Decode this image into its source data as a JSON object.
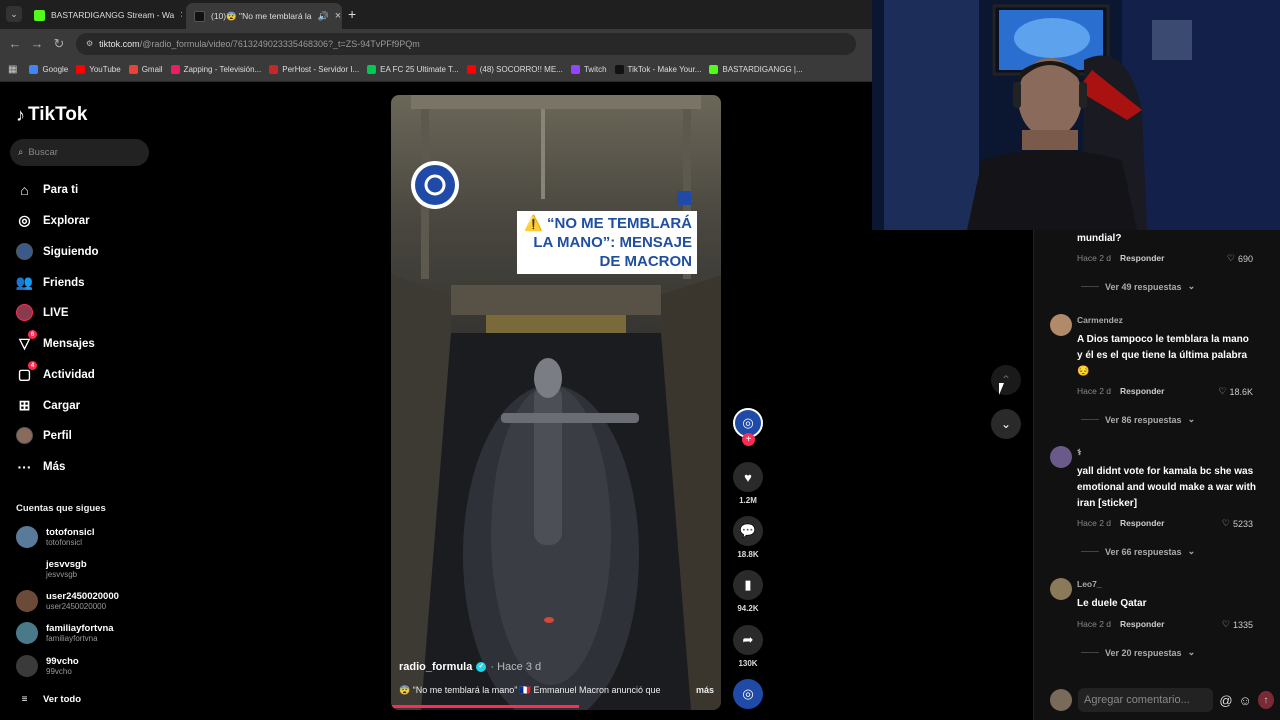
{
  "tabs": [
    {
      "label": "BASTARDIGANGG Stream - Wa",
      "color": "#53fc18",
      "active": false
    },
    {
      "label": "(10)😨 \"No me temblará la",
      "color": "#111111",
      "active": true
    }
  ],
  "address": {
    "host": "tiktok.com",
    "path": "/@radio_formula/video/7613249023335468306?_t=ZS-94TvPFf9PQm"
  },
  "bookmarks": [
    {
      "label": "Google",
      "color": "#4285f4"
    },
    {
      "label": "YouTube",
      "color": "#ff0000"
    },
    {
      "label": "Gmail",
      "color": "#ea4335"
    },
    {
      "label": "Zapping - Televisión...",
      "color": "#e91e63"
    },
    {
      "label": "PerHost - Servidor I...",
      "color": "#c62828"
    },
    {
      "label": "EA FC 25 Ultimate T...",
      "color": "#00c853"
    },
    {
      "label": "(48) SOCORRO!! ME...",
      "color": "#ff0000"
    },
    {
      "label": "Twitch",
      "color": "#9146ff"
    },
    {
      "label": "TikTok - Make Your...",
      "color": "#111111"
    },
    {
      "label": "BASTARDIGANGG |...",
      "color": "#53fc18"
    }
  ],
  "sidebar": {
    "logo": "TikTok",
    "search_placeholder": "Buscar",
    "nav": [
      {
        "label": "Para ti",
        "icon": "home-icon",
        "glyph": "⌂"
      },
      {
        "label": "Explorar",
        "icon": "compass-icon",
        "glyph": "◎"
      },
      {
        "label": "Siguiendo",
        "icon": "following-icon",
        "glyph": "●"
      },
      {
        "label": "Friends",
        "icon": "friends-icon",
        "glyph": "👥"
      },
      {
        "label": "LIVE",
        "icon": "live-icon",
        "glyph": "●"
      },
      {
        "label": "Mensajes",
        "icon": "messages-icon",
        "glyph": "▽",
        "badge": "6"
      },
      {
        "label": "Actividad",
        "icon": "activity-icon",
        "glyph": "▢",
        "badge": "4"
      },
      {
        "label": "Cargar",
        "icon": "upload-icon",
        "glyph": "⊞"
      },
      {
        "label": "Perfil",
        "icon": "profile-icon",
        "glyph": "●"
      },
      {
        "label": "Más",
        "icon": "more-icon",
        "glyph": "···"
      }
    ],
    "following_title": "Cuentas que sigues",
    "accounts": [
      {
        "name": "totofonsicl",
        "user": "totofonsicl",
        "color": "#5a7a9a"
      },
      {
        "name": "jesvvsgb",
        "user": "jesvvsgb",
        "color": "#000000"
      },
      {
        "name": "user2450020000",
        "user": "user2450020000",
        "color": "#6b4a3a"
      },
      {
        "name": "familiayfortvna",
        "user": "familiayfortvna",
        "color": "#4a7a8a"
      },
      {
        "name": "99vcho",
        "user": "99vcho",
        "color": "#3a3a3a"
      }
    ],
    "see_all": "Ver todo"
  },
  "video": {
    "caption": "⚠️ “NO ME TEMBLARÁ LA MANO”: MENSAJE DE MACRON",
    "channel": "radio_formula",
    "time": "· Hace 3 d",
    "description": "😨 “No me temblará la mano” 🇫🇷 Emmanuel Macron anunció que",
    "more": "más",
    "progress": 0.57
  },
  "actions": {
    "likes": "1.2M",
    "comments": "18.8K",
    "saves": "94.2K",
    "shares": "130K"
  },
  "comments": [
    {
      "user": "",
      "text": "mundial?",
      "time": "Hace 2 d",
      "reply": "Responder",
      "likes": "690",
      "replies": "Ver 49 respuestas"
    },
    {
      "user": "Carmendez",
      "text": "A Dios tampoco le temblara la mano y él es el que tiene la última palabra 😔",
      "time": "Hace 2 d",
      "reply": "Responder",
      "likes": "18.6K",
      "replies": "Ver 86 respuestas"
    },
    {
      "user": "⚕",
      "text": "yall didnt vote for kamala bc she was emotional and would make a war with iran [sticker]",
      "time": "Hace 2 d",
      "reply": "Responder",
      "likes": "5233",
      "replies": "Ver 66 respuestas"
    },
    {
      "user": "Leo7_",
      "text": "Le duele Qatar",
      "time": "Hace 2 d",
      "reply": "Responder",
      "likes": "1335",
      "replies": "Ver 20 respuestas"
    }
  ],
  "comment_input": {
    "placeholder": "Agregar comentario..."
  }
}
